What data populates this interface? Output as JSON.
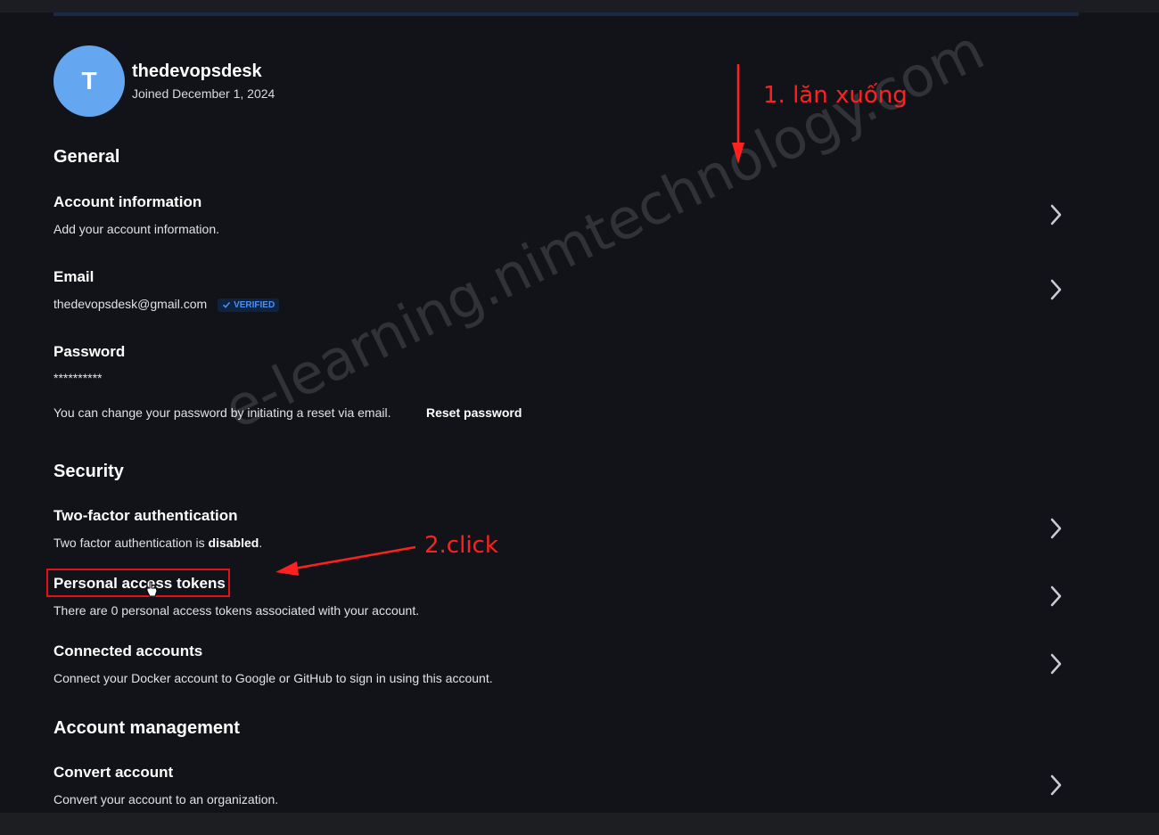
{
  "profile": {
    "avatar_initial": "T",
    "username": "thedevopsdesk",
    "joined": "Joined December 1, 2024"
  },
  "general": {
    "title": "General",
    "account_info": {
      "title": "Account information",
      "desc": "Add your account information."
    },
    "email": {
      "title": "Email",
      "value": "thedevopsdesk@gmail.com",
      "badge": "VERIFIED"
    },
    "password": {
      "title": "Password",
      "masked": "**********",
      "help_text": "You can change your password by initiating a reset via email.",
      "reset_label": "Reset password"
    }
  },
  "security": {
    "title": "Security",
    "two_factor": {
      "title": "Two-factor authentication",
      "desc_prefix": "Two factor authentication is ",
      "status": "disabled",
      "desc_suffix": "."
    },
    "tokens": {
      "title": "Personal access tokens",
      "desc": "There are 0 personal access tokens associated with your account."
    },
    "connected": {
      "title": "Connected accounts",
      "desc": "Connect your Docker account to Google or GitHub to sign in using this account."
    }
  },
  "account_management": {
    "title": "Account management",
    "convert": {
      "title": "Convert account",
      "desc": "Convert your account to an organization."
    }
  },
  "annotations": {
    "step1": "1. lăn xuống",
    "step2": "2.click",
    "watermark": "e-learning.nimtechnology.com",
    "color": "#ff2020"
  },
  "colors": {
    "background": "#111319",
    "avatar": "#64a7f0",
    "verified": "#4d8ff0"
  }
}
